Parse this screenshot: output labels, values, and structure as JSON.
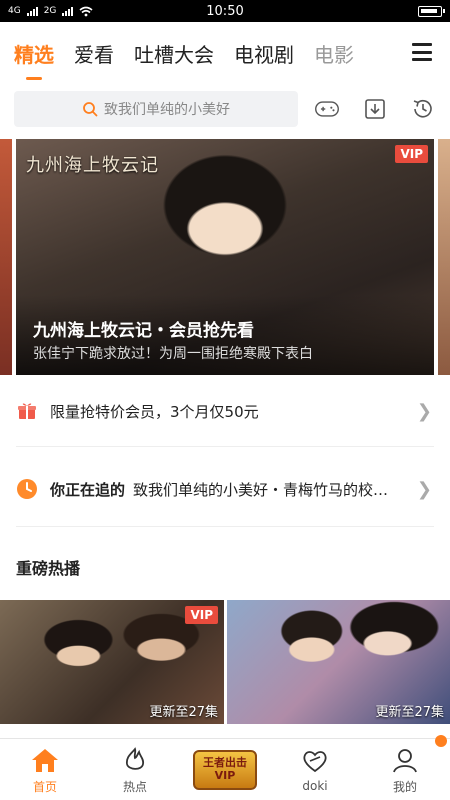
{
  "statusbar": {
    "signal1": "4G",
    "signal2": "2G",
    "time": "10:50"
  },
  "topnav": {
    "tabs": [
      {
        "label": "精选",
        "active": true
      },
      {
        "label": "爱看",
        "active": false
      },
      {
        "label": "吐槽大会",
        "active": false
      },
      {
        "label": "电视剧",
        "active": false
      },
      {
        "label": "电影",
        "active": false
      }
    ],
    "menu_icon": "hamburger-menu-icon"
  },
  "search": {
    "placeholder": "致我们单纯的小美好",
    "icon": "search-icon",
    "actions": [
      "gamepad-icon",
      "download-icon",
      "history-icon"
    ]
  },
  "banner": {
    "logo_text": "九州海上牧云记",
    "vip": "VIP",
    "title": "九州海上牧云记・会员抢先看",
    "subtitle": "张佳宁下跪求放过！为周一围拒绝寒殿下表白"
  },
  "rows": {
    "promo": {
      "icon": "gift-icon",
      "text": "限量抢特价会员，3个月仅50元"
    },
    "following": {
      "icon": "clock-icon",
      "lead": "你正在追的",
      "text": "致我们单纯的小美好・青梅竹马的校…"
    }
  },
  "section": {
    "title": "重磅热播"
  },
  "thumbnails": [
    {
      "vip": "VIP",
      "episode": "更新至27集"
    },
    {
      "episode": "更新至27集"
    }
  ],
  "bottomnav": {
    "items": [
      {
        "label": "首页",
        "icon": "home-icon",
        "active": true
      },
      {
        "label": "热点",
        "icon": "flame-icon",
        "active": false
      },
      {
        "label": "王者出击",
        "sub": "VIP",
        "icon": "game-badge-icon",
        "active": false
      },
      {
        "label": "doki",
        "icon": "heart-icon",
        "active": false
      },
      {
        "label": "我的",
        "icon": "user-icon",
        "active": false
      }
    ],
    "accent": "#ff7f1e"
  },
  "colors": {
    "accent": "#ff7f1e",
    "vip_red": "#e94c3d"
  }
}
